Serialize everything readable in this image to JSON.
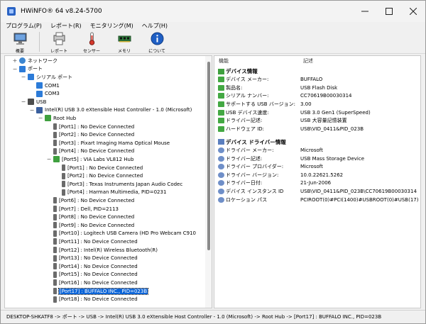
{
  "window": {
    "title": "HWiNFO® 64 v8.24-5700"
  },
  "menu": [
    "プログラム(P)",
    "レポート(R)",
    "モニタリング(M)",
    "ヘルプ(H)"
  ],
  "toolbar": [
    {
      "label": "概要",
      "icon": "computer-icon"
    },
    {
      "label": "レポート",
      "icon": "report-icon"
    },
    {
      "label": "センサー",
      "icon": "thermometer-icon"
    },
    {
      "label": "メモリ",
      "icon": "memory-icon"
    },
    {
      "label": "について",
      "icon": "info-icon"
    }
  ],
  "tree": [
    {
      "label": "ネットワーク",
      "depth": 1,
      "icon": "net",
      "toggle": "+"
    },
    {
      "label": "ポート",
      "depth": 1,
      "icon": "port",
      "toggle": "−"
    },
    {
      "label": "シリアル ポート",
      "depth": 2,
      "icon": "port",
      "toggle": "−"
    },
    {
      "label": "COM1",
      "depth": 3,
      "icon": "port"
    },
    {
      "label": "COM3",
      "depth": 3,
      "icon": "port"
    },
    {
      "label": "USB",
      "depth": 2,
      "icon": "usbhub",
      "toggle": "−"
    },
    {
      "label": "Intel(R) USB 3.0 eXtensible Host Controller - 1.0 (Microsoft)",
      "depth": 3,
      "icon": "usbctl",
      "toggle": "−"
    },
    {
      "label": "Root Hub",
      "depth": 4,
      "icon": "usbgreen",
      "toggle": "−"
    },
    {
      "label": "[Port1] : No Device Connected",
      "depth": 5,
      "icon": "usbdev"
    },
    {
      "label": "[Port2] : No Device Connected",
      "depth": 5,
      "icon": "usbdev"
    },
    {
      "label": "[Port3] : Pixart Imaging Hama Optical Mouse",
      "depth": 5,
      "icon": "usbdev"
    },
    {
      "label": "[Port4] : No Device Connected",
      "depth": 5,
      "icon": "usbdev"
    },
    {
      "label": "[Port5] : VIA Labs VL812 Hub",
      "depth": 5,
      "icon": "usbgreen",
      "toggle": "−"
    },
    {
      "label": "[Port1] : No Device Connected",
      "depth": 6,
      "icon": "usbdev"
    },
    {
      "label": "[Port2] : No Device Connected",
      "depth": 6,
      "icon": "usbdev"
    },
    {
      "label": "[Port3] : Texas Instruments Japan Audio Codec",
      "depth": 6,
      "icon": "usbdev"
    },
    {
      "label": "[Port4] : Harman Multimedia, PID=0231",
      "depth": 6,
      "icon": "usbdev"
    },
    {
      "label": "[Port6] : No Device Connected",
      "depth": 5,
      "icon": "usbdev"
    },
    {
      "label": "[Port7] : Dell, PID=2113",
      "depth": 5,
      "icon": "usbdev"
    },
    {
      "label": "[Port8] : No Device Connected",
      "depth": 5,
      "icon": "usbdev"
    },
    {
      "label": "[Port9] : No Device Connected",
      "depth": 5,
      "icon": "usbdev"
    },
    {
      "label": "[Port10] : Logitech USB Camera (HD Pro Webcam C910",
      "depth": 5,
      "icon": "usbdev"
    },
    {
      "label": "[Port11] : No Device Connected",
      "depth": 5,
      "icon": "usbdev"
    },
    {
      "label": "[Port12] : Intel(R) Wireless Bluetooth(R)",
      "depth": 5,
      "icon": "usbdev"
    },
    {
      "label": "[Port13] : No Device Connected",
      "depth": 5,
      "icon": "usbdev"
    },
    {
      "label": "[Port14] : No Device Connected",
      "depth": 5,
      "icon": "usbdev"
    },
    {
      "label": "[Port15] : No Device Connected",
      "depth": 5,
      "icon": "usbdev"
    },
    {
      "label": "[Port16] : No Device Connected",
      "depth": 5,
      "icon": "usbdev"
    },
    {
      "label": "[Port17] : BUFFALO INC., PID=023B",
      "depth": 5,
      "icon": "usbdev",
      "selected": true
    },
    {
      "label": "[Port18] : No Device Connected",
      "depth": 5,
      "icon": "usbdev"
    }
  ],
  "details": {
    "col_feature": "機能",
    "col_desc": "記述",
    "sections": [
      {
        "title": "デバイス情報",
        "icon": "usb-device-icon",
        "rows": [
          {
            "key": "デバイス メーカー:",
            "value": "BUFFALO",
            "icon": "green-usb-icon"
          },
          {
            "key": "製品名:",
            "value": "USB Flash Disk",
            "icon": "green-usb-icon"
          },
          {
            "key": "シリアル ナンバー:",
            "value": "CC70619B00030314",
            "icon": "green-usb-icon"
          },
          {
            "key": "サポートする USB バージョン:",
            "value": "3.00",
            "icon": "green-usb-icon"
          },
          {
            "key": "USB デバイス速度:",
            "value": "USB 3.0 Gen1 (SuperSpeed)",
            "icon": "green-usb-icon"
          },
          {
            "key": "ドライバー記述:",
            "value": "USB 大容量記憶装置",
            "icon": "green-usb-icon"
          },
          {
            "key": "ハードウェア ID:",
            "value": "USB\\VID_0411&PID_023B",
            "icon": "green-usb-icon"
          }
        ]
      },
      {
        "title": "デバイス ドライバー情報",
        "icon": "driver-icon",
        "rows": [
          {
            "key": "ドライバー メーカー:",
            "value": "Microsoft",
            "icon": "gear-icon"
          },
          {
            "key": "ドライバー記述:",
            "value": "USB Mass Storage Device",
            "icon": "gear-icon"
          },
          {
            "key": "ドライバー プロバイダー:",
            "value": "Microsoft",
            "icon": "gear-icon"
          },
          {
            "key": "ドライバー バージョン:",
            "value": "10.0.22621.5262",
            "icon": "gear-icon"
          },
          {
            "key": "ドライバー日付:",
            "value": "21-Jun-2006",
            "icon": "gear-icon"
          },
          {
            "key": "デバイス インスタンス ID",
            "value": "USB\\VID_0411&PID_023B\\CC70619B00030314",
            "icon": "gear-icon"
          },
          {
            "key": "ロケーション パス",
            "value": "PCIROOT(0)#PCI(1400)#USBROOT(0)#USB(17)",
            "icon": "gear-icon"
          }
        ]
      }
    ]
  },
  "status": "DESKTOP-SHKATF8 -> ポート -> USB -> Intel(R) USB 3.0 eXtensible Host Controller - 1.0 (Microsoft) -> Root Hub -> [Port17] : BUFFALO INC., PID=023B"
}
